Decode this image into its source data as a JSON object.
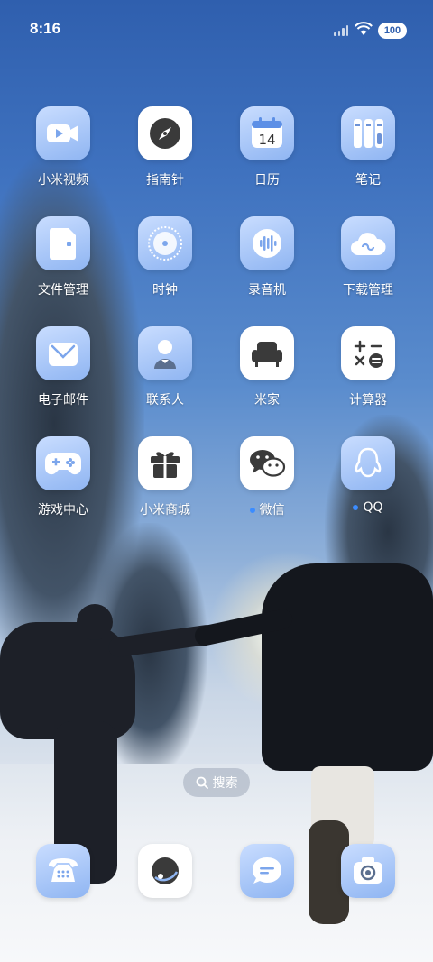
{
  "status": {
    "time": "8:16",
    "battery": "100"
  },
  "apps": [
    {
      "label": "小米视频",
      "icon": "video-camera-icon"
    },
    {
      "label": "指南针",
      "icon": "compass-icon"
    },
    {
      "label": "日历",
      "icon": "calendar-icon",
      "day": "14"
    },
    {
      "label": "笔记",
      "icon": "notes-icon"
    },
    {
      "label": "文件管理",
      "icon": "file-manager-icon"
    },
    {
      "label": "时钟",
      "icon": "clock-icon"
    },
    {
      "label": "录音机",
      "icon": "voice-recorder-icon"
    },
    {
      "label": "下载管理",
      "icon": "download-cloud-icon"
    },
    {
      "label": "电子邮件",
      "icon": "email-icon"
    },
    {
      "label": "联系人",
      "icon": "contacts-icon"
    },
    {
      "label": "米家",
      "icon": "mi-home-sofa-icon"
    },
    {
      "label": "计算器",
      "icon": "calculator-icon"
    },
    {
      "label": "游戏中心",
      "icon": "gamepad-icon"
    },
    {
      "label": "小米商城",
      "icon": "gift-box-icon"
    },
    {
      "label": "微信",
      "icon": "wechat-icon"
    },
    {
      "label": "QQ",
      "icon": "qq-penguin-icon"
    }
  ],
  "search": {
    "label": "搜索"
  },
  "dock": [
    {
      "icon": "phone-icon"
    },
    {
      "icon": "browser-planet-icon"
    },
    {
      "icon": "messages-icon"
    },
    {
      "icon": "camera-icon"
    }
  ],
  "colors": {
    "accent": "#3b8cff",
    "icon_glass": "#a9c8f7",
    "dark_icon": "#3a3a3a"
  }
}
